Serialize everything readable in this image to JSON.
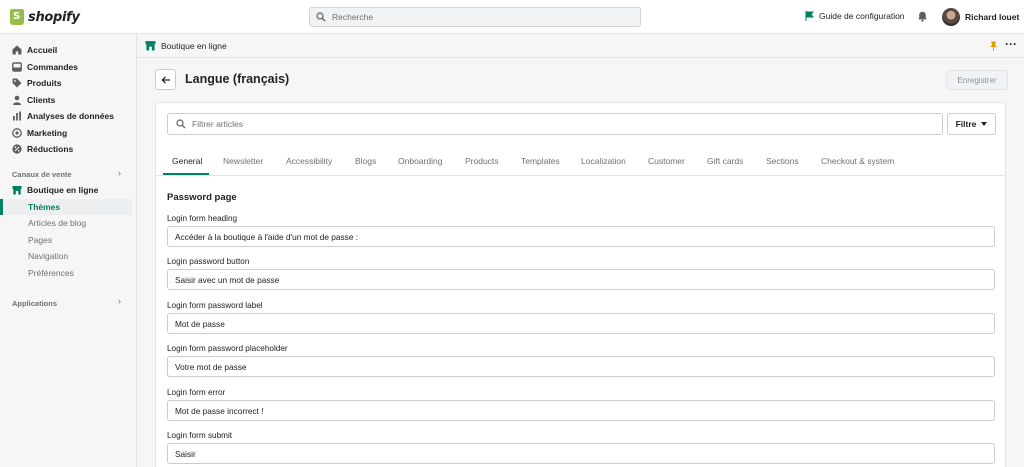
{
  "topbar": {
    "brand": "shopify",
    "search_placeholder": "Recherche",
    "guide_label": "Guide de configuration",
    "user_name": "Richard louet"
  },
  "sidebar": {
    "items": [
      {
        "label": "Accueil",
        "icon": "home-icon"
      },
      {
        "label": "Commandes",
        "icon": "orders-icon"
      },
      {
        "label": "Produits",
        "icon": "tag-icon"
      },
      {
        "label": "Clients",
        "icon": "person-icon"
      },
      {
        "label": "Analyses de données",
        "icon": "bar-chart-icon"
      },
      {
        "label": "Marketing",
        "icon": "target-icon"
      },
      {
        "label": "Réductions",
        "icon": "discount-icon"
      }
    ],
    "sales_channels_label": "Canaux de vente",
    "online_store_label": "Boutique en ligne",
    "sub_items": [
      "Thèmes",
      "Articles de blog",
      "Pages",
      "Navigation",
      "Préférences"
    ],
    "apps_label": "Applications"
  },
  "breadcrumb": {
    "label": "Boutique en ligne"
  },
  "page": {
    "title": "Langue (français)",
    "save_label": "Enregistrer"
  },
  "filter": {
    "placeholder": "Filtrer articles",
    "button_label": "Filtre"
  },
  "tabs": [
    "General",
    "Newsletter",
    "Accessibility",
    "Blogs",
    "Onboarding",
    "Products",
    "Templates",
    "Localization",
    "Customer",
    "Gift cards",
    "Sections",
    "Checkout & system"
  ],
  "active_tab": "General",
  "section": {
    "title": "Password page",
    "fields": [
      {
        "label": "Login form heading",
        "value": "Accéder à la boutique à l'aide d'un mot de passe :"
      },
      {
        "label": "Login password button",
        "value": "Saisir avec un mot de passe"
      },
      {
        "label": "Login form password label",
        "value": "Mot de passe"
      },
      {
        "label": "Login form password placeholder",
        "value": "Votre mot de passe"
      },
      {
        "label": "Login form error",
        "value": "Mot de passe incorrect !"
      },
      {
        "label": "Login form submit",
        "value": "Saisir"
      }
    ]
  },
  "colors": {
    "accent": "#008060",
    "brand": "#95bf47"
  }
}
